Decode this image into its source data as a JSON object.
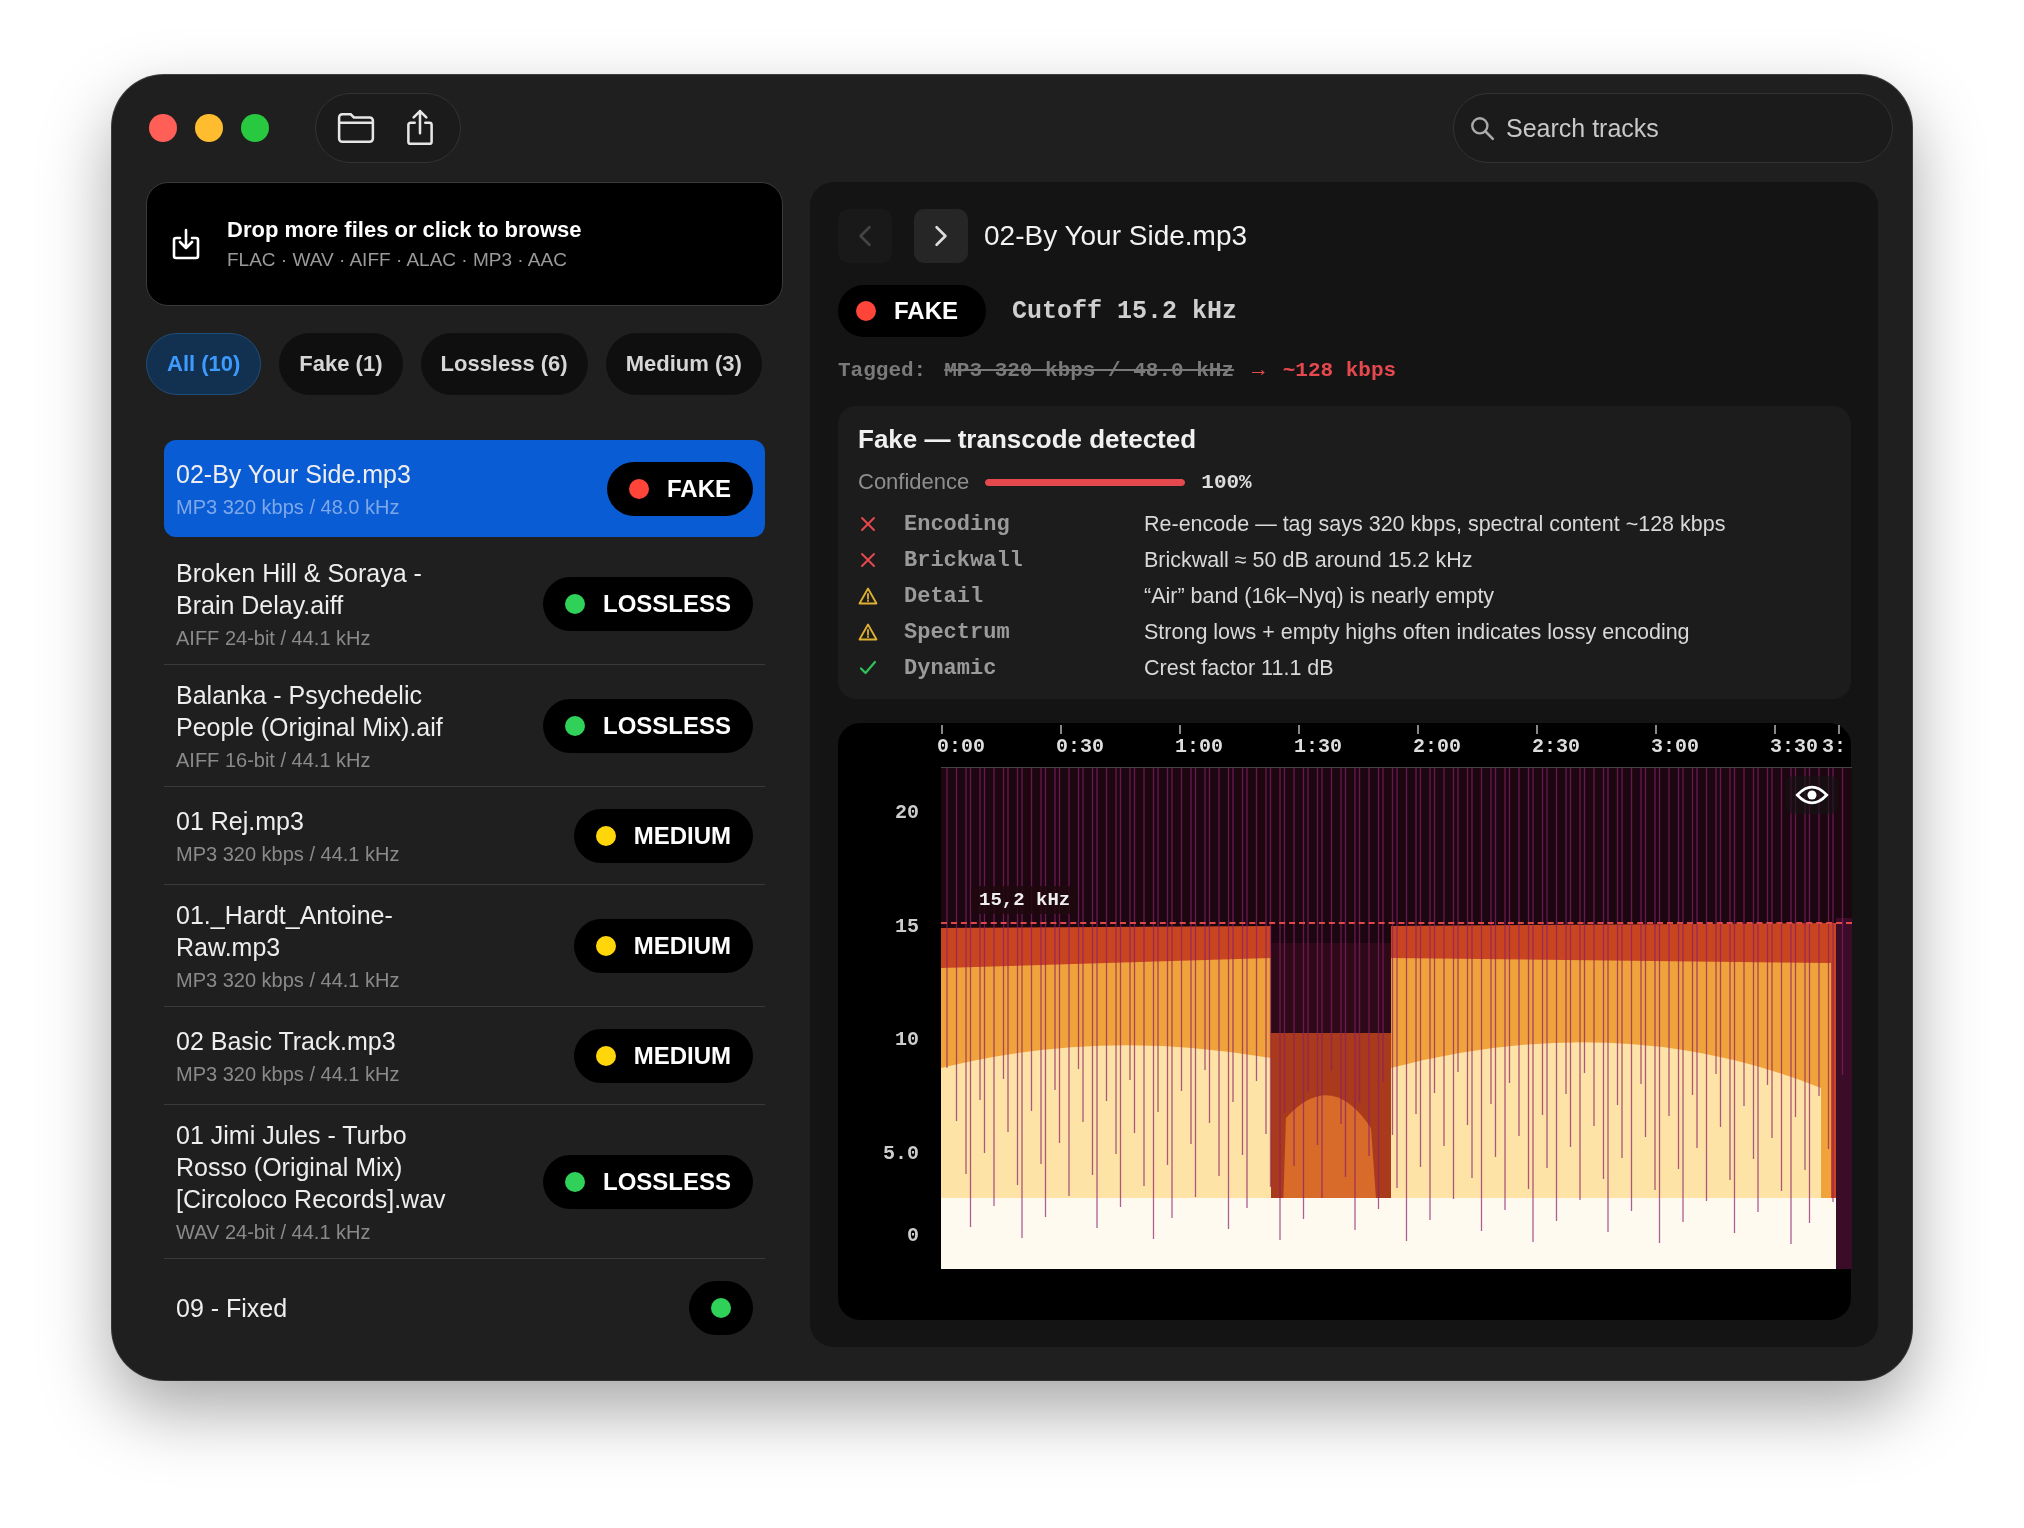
{
  "search": {
    "placeholder": "Search tracks"
  },
  "drop_zone": {
    "title": "Drop more files or click to browse",
    "formats": "FLAC · WAV · AIFF · ALAC · MP3 · AAC"
  },
  "filters": [
    {
      "label": "All (10)",
      "selected": true
    },
    {
      "label": "Fake (1)",
      "selected": false
    },
    {
      "label": "Lossless (6)",
      "selected": false
    },
    {
      "label": "Medium (3)",
      "selected": false
    }
  ],
  "tracks": [
    {
      "title": "02-By Your Side.mp3",
      "format": "MP3 320 kbps / 48.0 kHz",
      "badge": "FAKE",
      "color": "#ff453a",
      "selected": true
    },
    {
      "title": "Broken Hill & Soraya - Brain Delay.aiff",
      "format": "AIFF 24-bit / 44.1 kHz",
      "badge": "LOSSLESS",
      "color": "#30d158",
      "selected": false
    },
    {
      "title": "Balanka - Psychedelic People (Original Mix).aif",
      "format": "AIFF 16-bit / 44.1 kHz",
      "badge": "LOSSLESS",
      "color": "#30d158",
      "selected": false
    },
    {
      "title": "01 Rej.mp3",
      "format": "MP3 320 kbps / 44.1 kHz",
      "badge": "MEDIUM",
      "color": "#ffd60a",
      "selected": false
    },
    {
      "title": "01._Hardt_Antoine-Raw.mp3",
      "format": "MP3 320 kbps / 44.1 kHz",
      "badge": "MEDIUM",
      "color": "#ffd60a",
      "selected": false
    },
    {
      "title": "02 Basic Track.mp3",
      "format": "MP3 320 kbps / 44.1 kHz",
      "badge": "MEDIUM",
      "color": "#ffd60a",
      "selected": false
    },
    {
      "title": "01 Jimi Jules - Turbo Rosso (Original Mix) [Circoloco Records].wav",
      "format": "WAV 24-bit / 44.1 kHz",
      "badge": "LOSSLESS",
      "color": "#30d158",
      "selected": false
    },
    {
      "title": "09 - Fixed",
      "color": "#30d158",
      "selected": false
    }
  ],
  "detail": {
    "title": "02-By Your Side.mp3",
    "prev_disabled": true,
    "verdict": {
      "label": "FAKE",
      "color": "#ff453a"
    },
    "cutoff": "Cutoff 15.2 kHz",
    "tagged_label": "Tagged:",
    "tagged_value": "MP3 320 kbps / 48.0 kHz",
    "arrow": "→",
    "actual": "~128 kbps"
  },
  "analysis": {
    "title": "Fake — transcode detected",
    "confidence_label": "Confidence",
    "level": 1,
    "confidence_value": "100%",
    "checks": [
      {
        "kind": "fail",
        "name": "Encoding",
        "detail": "Re-encode — tag says 320 kbps, spectral content ~128 kbps"
      },
      {
        "kind": "fail",
        "name": "Brickwall",
        "detail": "Brickwall ≈ 50 dB around 15.2 kHz"
      },
      {
        "kind": "warn",
        "name": "Detail",
        "detail": "“Air” band (16k–Nyq) is nearly empty"
      },
      {
        "kind": "warn",
        "name": "Spectrum",
        "detail": "Strong lows + empty highs often indicates lossy encoding"
      },
      {
        "kind": "pass",
        "name": "Dynamic",
        "detail": "Crest factor 11.1 dB"
      }
    ]
  },
  "spectrogram": {
    "x_labels": [
      "0:00",
      "0:30",
      "1:00",
      "1:30",
      "2:00",
      "2:30",
      "3:00",
      "3:30",
      "3:"
    ],
    "y_labels": [
      "20",
      "15",
      "10",
      "5.0",
      "0"
    ],
    "cutoff_label": "15,2 kHz"
  }
}
